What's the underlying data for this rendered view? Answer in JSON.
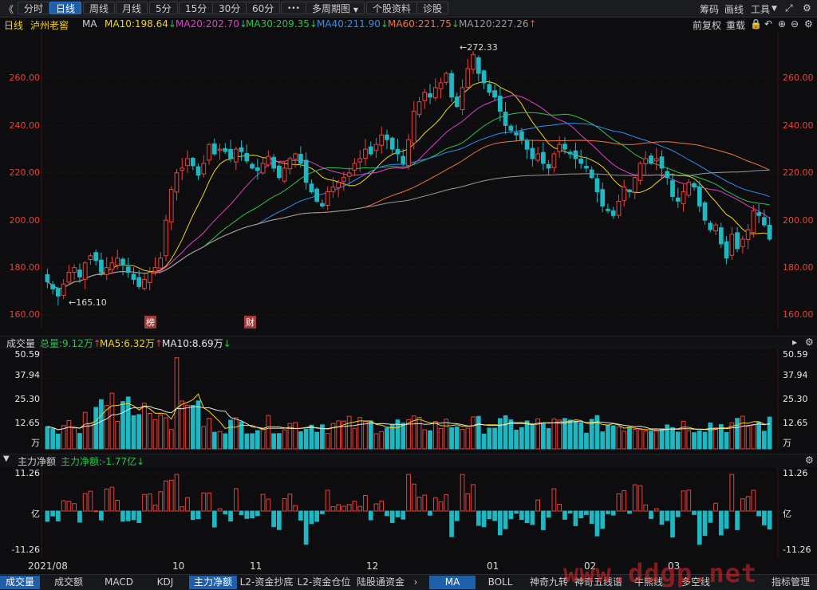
{
  "toolbar": {
    "back_glyph": "《",
    "periods": [
      "分时",
      "日线",
      "周线",
      "月线",
      "5分",
      "15分",
      "30分",
      "60分"
    ],
    "active_period": "日线",
    "more_glyph": "•••",
    "multi_period": "多周期图",
    "stock_info": "个股资料",
    "diagnose": "诊股",
    "right": [
      "筹码",
      "画线",
      "工具"
    ],
    "colors": {
      "active": "#1f5fa8"
    }
  },
  "ma_bar": {
    "period": "日线",
    "stock_name": "泸州老窖",
    "ma_label": "MA",
    "items": [
      {
        "text": "MA10:198.64",
        "arrow": "↓",
        "color": "#f2d31b"
      },
      {
        "text": "MA20:202.70",
        "arrow": "↓",
        "color": "#e040c8"
      },
      {
        "text": "MA30:209.35",
        "arrow": "↓",
        "color": "#2ec24a"
      },
      {
        "text": "MA40:211.90",
        "arrow": "↓",
        "color": "#2f8ef0"
      },
      {
        "text": "MA60:221.75",
        "arrow": "↓",
        "color": "#f0743a"
      },
      {
        "text": "MA120:227.26",
        "arrow": "↑",
        "color": "#9a9a9a"
      }
    ],
    "adjust": "前复权",
    "overlay": "重载"
  },
  "main_chart": {
    "price_ticks": [
      "260.00",
      "240.00",
      "220.00",
      "200.00",
      "180.00",
      "160.00"
    ],
    "high_label": "←272.33",
    "low_label": "←165.10",
    "event_markers": [
      "榜",
      "财"
    ]
  },
  "volume_panel": {
    "title": "成交量",
    "total": "总量:9.12万",
    "total_arrow": "↑",
    "ma5": "MA5:6.32万",
    "ma5_arrow": "↑",
    "ma10": "MA10:8.69万",
    "ma10_arrow": "↓",
    "ticks": [
      "50.59",
      "37.94",
      "25.30",
      "12.65",
      "万"
    ]
  },
  "flow_panel": {
    "title": "主力净额",
    "value": "主力净额:-1.77亿",
    "value_arrow": "↓",
    "ticks": [
      "11.26",
      "亿",
      "-11.26"
    ]
  },
  "date_axis": [
    "2021/08",
    "10",
    "11",
    "12",
    "01",
    "02",
    "03"
  ],
  "bottom_tabs": {
    "left": [
      "成交量",
      "成交额",
      "MACD",
      "KDJ",
      "主力净额",
      "L2-资金抄底",
      "L2-资金仓位",
      "陆股通资金"
    ],
    "left_active": "主力净额",
    "right": [
      "MA",
      "BOLL",
      "神奇九转",
      "神奇五线谱",
      "牛熊线",
      "多空线",
      "指标管理"
    ],
    "right_active": "MA"
  },
  "watermark": "www.ddgp.net",
  "chart_data": {
    "type": "candlestick",
    "title": "泸州老窖 日线",
    "price_axis": {
      "range": [
        160,
        275
      ],
      "ticks": [
        160,
        180,
        200,
        220,
        240,
        260
      ]
    },
    "high": 272.33,
    "low": 165.1,
    "series_colors": {
      "up": "#e8433a",
      "down": "#1fb8c2"
    },
    "closes": [
      174,
      171,
      168,
      173,
      178,
      180,
      176,
      182,
      185,
      183,
      178,
      180,
      182,
      184,
      181,
      178,
      175,
      172,
      175,
      178,
      180,
      184,
      200,
      213,
      220,
      222,
      226,
      223,
      219,
      224,
      232,
      228,
      230,
      229,
      226,
      230,
      229,
      225,
      222,
      221,
      224,
      227,
      222,
      218,
      222,
      226,
      228,
      224,
      216,
      212,
      208,
      206,
      212,
      214,
      216,
      218,
      220,
      224,
      226,
      230,
      228,
      232,
      236,
      234,
      230,
      228,
      224,
      234,
      246,
      250,
      254,
      252,
      256,
      258,
      262,
      252,
      248,
      256,
      264,
      270,
      262,
      258,
      254,
      252,
      246,
      240,
      238,
      236,
      234,
      230,
      226,
      228,
      224,
      222,
      228,
      232,
      230,
      228,
      226,
      224,
      222,
      218,
      212,
      206,
      204,
      202,
      208,
      214,
      212,
      218,
      224,
      226,
      224,
      226,
      222,
      218,
      210,
      208,
      212,
      216,
      214,
      206,
      200,
      196,
      198,
      190,
      184,
      194,
      188,
      192,
      196,
      204,
      202,
      198,
      192
    ]
  }
}
